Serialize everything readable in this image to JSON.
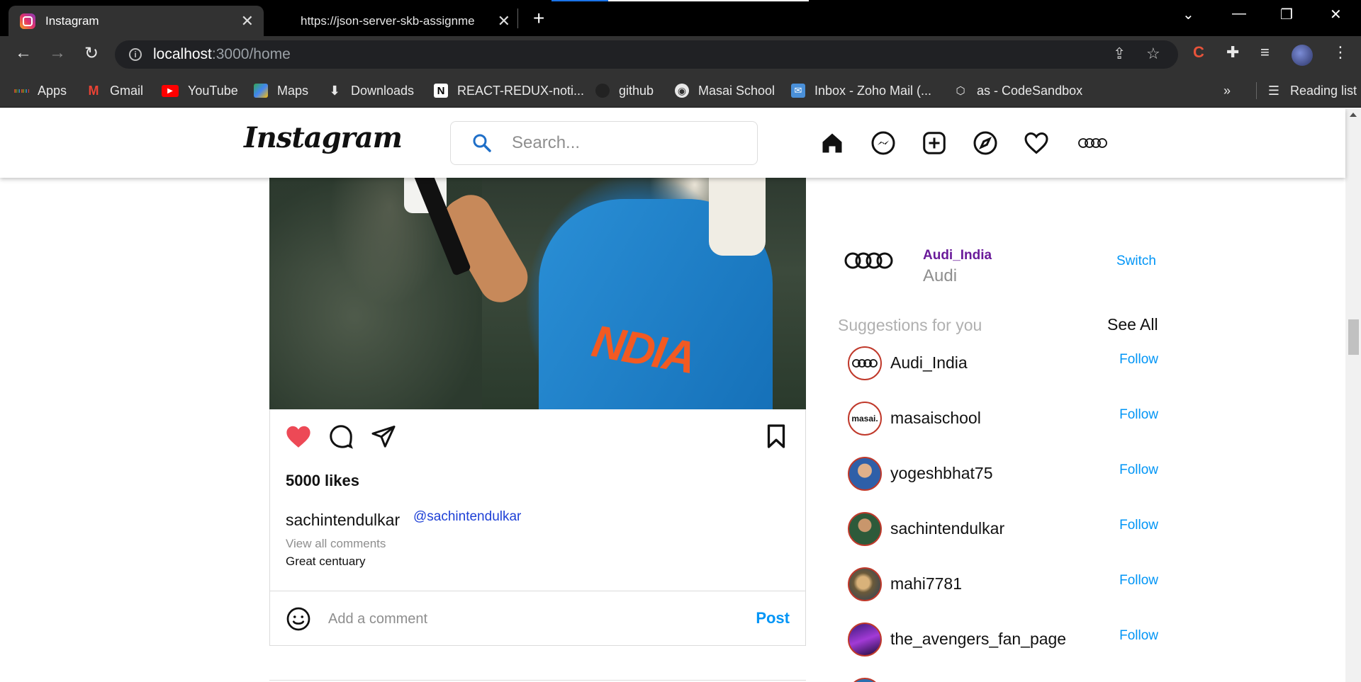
{
  "browser": {
    "tabs": [
      {
        "title": "Instagram",
        "active": true
      },
      {
        "title": "https://json-server-skb-assignme",
        "active": false
      }
    ],
    "url": {
      "host": "localhost",
      "path": ":3000/home"
    },
    "bookmarks": [
      {
        "label": "Apps",
        "icon": "apps-grid-icon"
      },
      {
        "label": "Gmail",
        "icon": "gmail-icon"
      },
      {
        "label": "YouTube",
        "icon": "youtube-icon"
      },
      {
        "label": "Maps",
        "icon": "maps-icon"
      },
      {
        "label": "Downloads",
        "icon": "download-icon"
      },
      {
        "label": "REACT-REDUX-noti...",
        "icon": "notion-icon"
      },
      {
        "label": "github",
        "icon": "github-icon"
      },
      {
        "label": "Masai School",
        "icon": "globe-icon"
      },
      {
        "label": "Inbox - Zoho Mail (...",
        "icon": "zoho-mail-icon"
      },
      {
        "label": "as - CodeSandbox",
        "icon": "codesandbox-icon"
      }
    ],
    "overflow_label": "»",
    "reading_list": "Reading list"
  },
  "header": {
    "logo": "Instagram",
    "search_placeholder": "Search..."
  },
  "post": {
    "likes": "5000 likes",
    "username": "sachintendulkar",
    "tag": "@sachintendulkar",
    "view_comments": "View all comments",
    "comment": "Great centuary",
    "comment_placeholder": "Add a comment",
    "post_button": "Post"
  },
  "sidebar": {
    "profile": {
      "username": "Audi_India",
      "name": "Audi",
      "switch_label": "Switch"
    },
    "suggestions_title": "Suggestions for you",
    "see_all": "See All",
    "suggestions": [
      {
        "username": "Audi_India",
        "action": "Follow",
        "avatar_text": "Audi rings"
      },
      {
        "username": "masaischool",
        "action": "Follow",
        "avatar_text": "masai."
      },
      {
        "username": "yogeshbhat75",
        "action": "Follow",
        "avatar_text": ""
      },
      {
        "username": "sachintendulkar",
        "action": "Follow",
        "avatar_text": ""
      },
      {
        "username": "mahi7781",
        "action": "Follow",
        "avatar_text": ""
      },
      {
        "username": "the_avengers_fan_page",
        "action": "Follow",
        "avatar_text": ""
      }
    ]
  },
  "colors": {
    "link_blue": "#0095f6",
    "heart_red": "#ed4956",
    "profile_purple": "#6a1b9a"
  }
}
